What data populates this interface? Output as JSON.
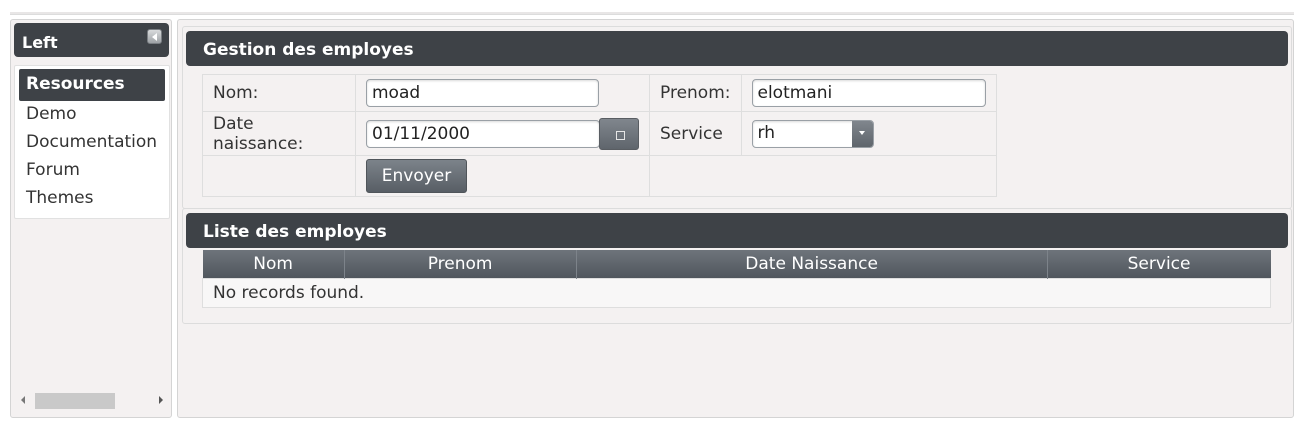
{
  "west": {
    "title": "Left",
    "menu": {
      "header": "Resources",
      "items": [
        "Demo",
        "Documentation",
        "Forum",
        "Themes"
      ]
    }
  },
  "form_panel": {
    "title": "Gestion des employes",
    "nom_label": "Nom:",
    "nom_value": "moad",
    "prenom_label": "Prenom:",
    "prenom_value": "elotmani",
    "date_label": "Date naissance:",
    "date_value": "01/11/2000",
    "service_label": "Service",
    "service_value": "rh",
    "submit_label": "Envoyer"
  },
  "list_panel": {
    "title": "Liste des employes",
    "columns": [
      "Nom",
      "Prenom",
      "Date Naissance",
      "Service"
    ],
    "empty_message": "No records found."
  },
  "colors": {
    "header_bg": "#3e4247",
    "panel_bg": "#f4f1f1",
    "button_bg": "#6a7077"
  }
}
